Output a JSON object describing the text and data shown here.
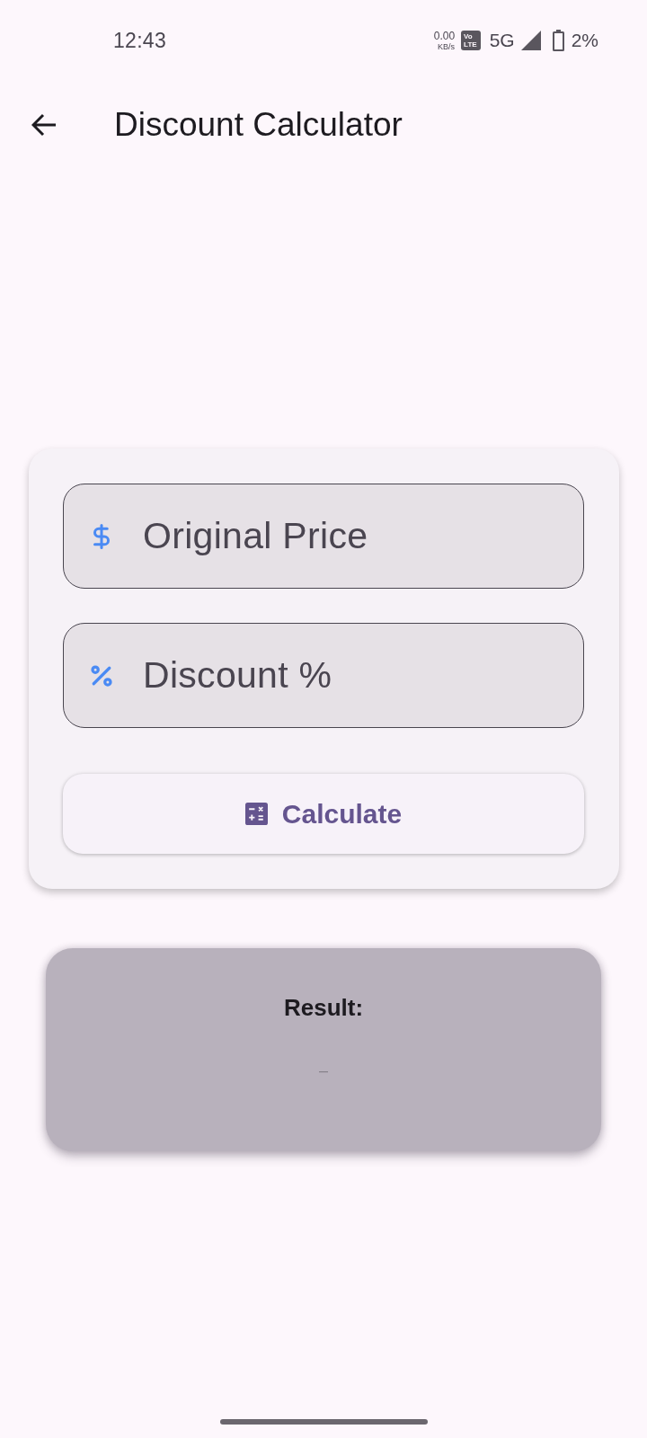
{
  "status_bar": {
    "time": "12:43",
    "net_speed": "0.00",
    "net_unit": "KB/s",
    "volte_badge": [
      "Vo",
      "LTE"
    ],
    "network": "5G",
    "battery": "2%"
  },
  "app_bar": {
    "title": "Discount Calculator"
  },
  "form": {
    "fields": [
      {
        "kind": "currency",
        "placeholder": "Original Price"
      },
      {
        "kind": "percentage",
        "placeholder": "Discount %"
      }
    ],
    "button": {
      "label": "Calculate"
    }
  },
  "result": {
    "label": "Result:",
    "value": "–"
  }
}
